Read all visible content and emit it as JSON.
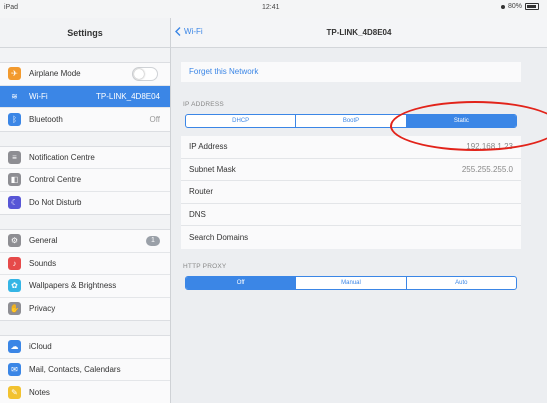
{
  "status_bar": {
    "device": "iPad",
    "time": "12:41",
    "battery": "80%"
  },
  "sidebar": {
    "title": "Settings",
    "groups": [
      [
        {
          "label": "Airplane Mode",
          "icon": "airplane-icon",
          "color": "#f29a2e",
          "control": "toggle"
        },
        {
          "label": "Wi-Fi",
          "detail": "TP-LINK_4D8E04",
          "icon": "wifi-icon",
          "color": "#3b86e6",
          "selected": true
        },
        {
          "label": "Bluetooth",
          "detail": "Off",
          "icon": "bluetooth-icon",
          "color": "#3b86e6"
        }
      ],
      [
        {
          "label": "Notification Centre",
          "icon": "notification-icon",
          "color": "#8e8e93"
        },
        {
          "label": "Control Centre",
          "icon": "control-centre-icon",
          "color": "#8e8e93"
        },
        {
          "label": "Do Not Disturb",
          "icon": "moon-icon",
          "color": "#5856d6"
        }
      ],
      [
        {
          "label": "General",
          "badge": "1",
          "icon": "gear-icon",
          "color": "#8e8e93"
        },
        {
          "label": "Sounds",
          "icon": "speaker-icon",
          "color": "#e64a4a"
        },
        {
          "label": "Wallpapers & Brightness",
          "icon": "flower-icon",
          "color": "#35b5e5"
        },
        {
          "label": "Privacy",
          "icon": "hand-icon",
          "color": "#8e8e93"
        }
      ],
      [
        {
          "label": "iCloud",
          "icon": "cloud-icon",
          "color": "#3b86e6"
        },
        {
          "label": "Mail, Contacts, Calendars",
          "icon": "mail-icon",
          "color": "#3b86e6"
        },
        {
          "label": "Notes",
          "icon": "notes-icon",
          "color": "#f2c230"
        }
      ]
    ]
  },
  "main": {
    "back_label": "Wi-Fi",
    "title": "TP-LINK_4D8E04",
    "forget_label": "Forget this Network",
    "ip_section_label": "IP ADDRESS",
    "ip_modes": [
      "DHCP",
      "BootP",
      "Static"
    ],
    "ip_selected": "Static",
    "fields": [
      {
        "label": "IP Address",
        "value": "192.168.1.23"
      },
      {
        "label": "Subnet Mask",
        "value": "255.255.255.0"
      },
      {
        "label": "Router",
        "value": ""
      },
      {
        "label": "DNS",
        "value": ""
      },
      {
        "label": "Search Domains",
        "value": ""
      }
    ],
    "proxy_section_label": "HTTP PROXY",
    "proxy_modes": [
      "Off",
      "Manual",
      "Auto"
    ],
    "proxy_selected": "Off"
  },
  "colors": {
    "accent": "#3b86e6",
    "annotation": "#e2231a"
  }
}
